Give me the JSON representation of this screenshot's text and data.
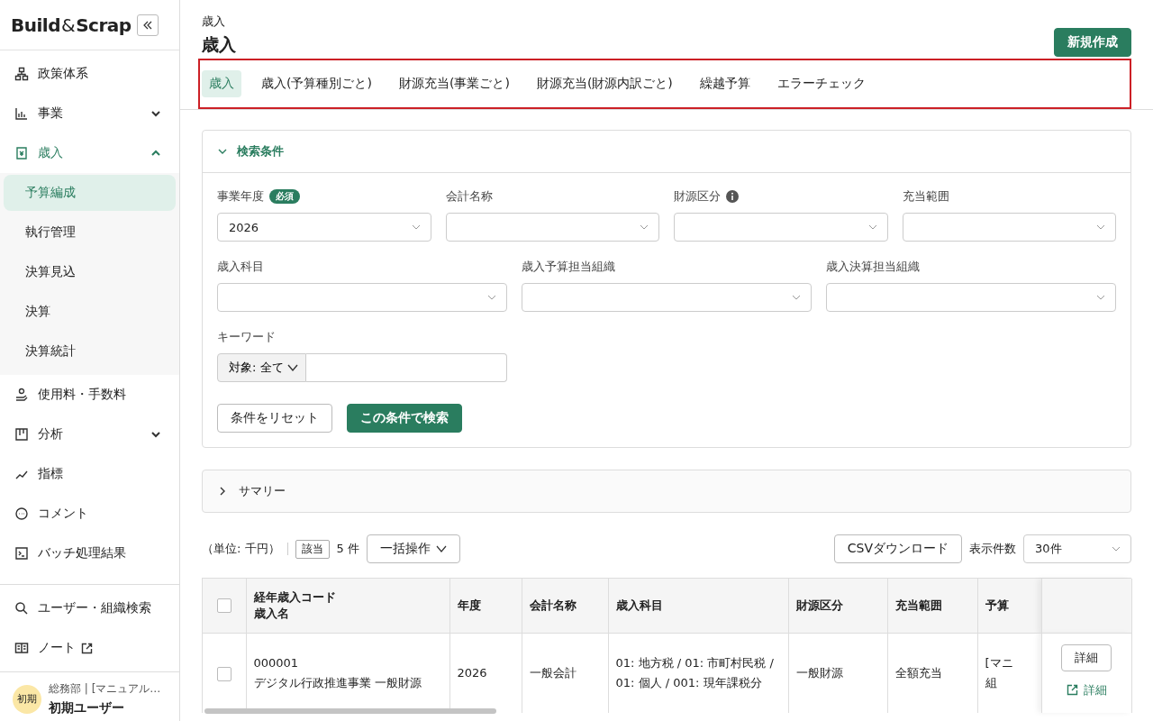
{
  "sidebar": {
    "logo": {
      "left": "Build",
      "amp": "&",
      "right": "Scrap"
    },
    "items": [
      {
        "label": "政策体系",
        "selected": false
      },
      {
        "label": "事業",
        "expanded": false,
        "selected": false
      },
      {
        "label": "歳入",
        "expanded": true,
        "selected": true,
        "children": [
          {
            "label": "予算編成",
            "selected": true
          },
          {
            "label": "執行管理",
            "selected": false
          },
          {
            "label": "決算見込",
            "selected": false
          },
          {
            "label": "決算",
            "selected": false
          },
          {
            "label": "決算統計",
            "selected": false
          }
        ]
      },
      {
        "label": "使用料・手数料",
        "selected": false
      },
      {
        "label": "分析",
        "expanded": false,
        "selected": false
      },
      {
        "label": "指標",
        "selected": false
      },
      {
        "label": "コメント",
        "selected": false
      },
      {
        "label": "バッチ処理結果",
        "selected": false
      }
    ],
    "tools": [
      {
        "label": "ユーザー・組織検索",
        "external": false
      },
      {
        "label": "ノート",
        "external": true
      }
    ],
    "user": {
      "avatar": "初期",
      "org": "総務部 | [マニュアル…",
      "name": "初期ユーザー"
    }
  },
  "header": {
    "breadcrumb": "歳入",
    "title": "歳入",
    "new_button": "新規作成"
  },
  "tabs": [
    {
      "label": "歳入",
      "selected": true
    },
    {
      "label": "歳入(予算種別ごと)",
      "selected": false
    },
    {
      "label": "財源充当(事業ごと)",
      "selected": false
    },
    {
      "label": "財源充当(財源内訳ごと)",
      "selected": false
    },
    {
      "label": "繰越予算",
      "selected": false
    },
    {
      "label": "エラーチェック",
      "selected": false
    }
  ],
  "search": {
    "title": "検索条件",
    "expanded": true,
    "row1": [
      {
        "label": "事業年度",
        "required": "必須",
        "info": false,
        "value": "2026"
      },
      {
        "label": "会計名称",
        "info": false
      },
      {
        "label": "財源区分",
        "info": true
      },
      {
        "label": "充当範囲",
        "info": false
      }
    ],
    "row2": [
      {
        "label": "歳入科目"
      },
      {
        "label": "歳入予算担当組織"
      },
      {
        "label": "歳入決算担当組織"
      }
    ],
    "keyword": {
      "label": "キーワード",
      "scope": "対象: 全て"
    },
    "reset_button": "条件をリセット",
    "search_button": "この条件で検索"
  },
  "summary": {
    "title": "サマリー",
    "expanded": false
  },
  "toolbar": {
    "unit": "（単位: 千円）",
    "hit_label": "該当",
    "count": "5 件",
    "bulk": "一括操作",
    "csv": "CSVダウンロード",
    "per_page_label": "表示件数",
    "per_page": "30件"
  },
  "table": {
    "all_checked": false,
    "columns": [
      {
        "lines": [
          "経年歳入コード",
          "歳入名"
        ]
      },
      {
        "lines": [
          "年度"
        ]
      },
      {
        "lines": [
          "会計名称"
        ]
      },
      {
        "lines": [
          "歳入科目"
        ]
      },
      {
        "lines": [
          "財源区分"
        ]
      },
      {
        "lines": [
          "充当範囲"
        ]
      },
      {
        "lines": [
          "予算"
        ]
      }
    ],
    "rows": [
      {
        "checked": false,
        "cells": [
          [
            "000001",
            "デジタル行政推進事業 一般財源"
          ],
          [
            "2026"
          ],
          [
            "一般会計"
          ],
          [
            "01: 地方税 / 01: 市町村民税 /",
            "01: 個人 / 001: 現年課税分"
          ],
          [
            "一般財源"
          ],
          [
            "全額充当"
          ],
          [
            "[マニ",
            "組"
          ]
        ],
        "detail_button": "詳細",
        "detail_link": "詳細"
      }
    ]
  }
}
